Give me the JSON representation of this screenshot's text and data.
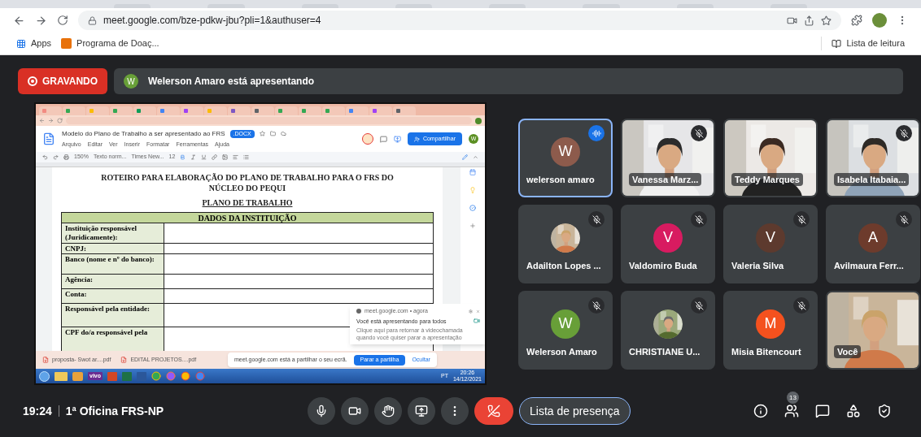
{
  "browser": {
    "url": "meet.google.com/bze-pdkw-jbu?pli=1&authuser=4",
    "bookmarks": [
      {
        "kind": "apps",
        "label": "Apps"
      },
      {
        "kind": "site",
        "label": "Programa de Doaç..."
      }
    ],
    "reading_list": "Lista de leitura"
  },
  "meet": {
    "recording": "GRAVANDO",
    "presenter": {
      "initial": "W",
      "text": "Welerson Amaro está apresentando"
    }
  },
  "shared_screen": {
    "doc": {
      "title": "Modelo do Plano de Trabalho a ser apresentado ao FRS",
      "badge": ".DOCX",
      "menu": [
        "Arquivo",
        "Editar",
        "Ver",
        "Inserir",
        "Formatar",
        "Ferramentas",
        "Ajuda"
      ],
      "share": "Compartilhar",
      "account": "W",
      "toolbar": [
        "150%",
        "Texto norm...",
        "Times New...",
        "12"
      ],
      "heading": "ROTEIRO PARA ELABORAÇÃO DO PLANO DE TRABALHO PARA O FRS DO NÚCLEO DO PEQUI",
      "subtitle": "PLANO DE TRABALHO",
      "table": {
        "header": "DADOS DA INSTITUIÇÃO",
        "rows": [
          "Instituição responsável (Juridicamente):",
          "CNPJ:",
          "Banco (nome e nº do banco):",
          "Agência:",
          "Conta:",
          "Responsável pela entidade:",
          "CPF do/a responsável pela"
        ]
      }
    },
    "downloads": [
      "proposta- Swot ar....pdf",
      "EDITAL PROJETOS....pdf"
    ],
    "share_bar": {
      "text": "meet.google.com está a partilhar o seu ecrã.",
      "stop": "Parar a partilha",
      "hide": "Ocultar"
    },
    "notification": {
      "source": "meet.google.com • agora",
      "title": "Você está apresentando para todos",
      "body": "Clique aqui para retornar à videochamada quando você quiser parar a apresentação"
    },
    "taskbar": {
      "vivo": "vivo",
      "lang": "PT",
      "time": "20:26",
      "date": "14/12/2021"
    }
  },
  "tiles": [
    {
      "name": "welerson amaro",
      "kind": "avatar",
      "initial": "W",
      "color": "#8d5b4c",
      "muted": false,
      "speaking": true,
      "selected": true
    },
    {
      "name": "Vanessa Marz...",
      "kind": "video",
      "muted": true,
      "speaking": false,
      "selected": false
    },
    {
      "name": "Teddy Marques",
      "kind": "video",
      "muted": false,
      "speaking": false,
      "selected": false
    },
    {
      "name": "Isabela Itabaia...",
      "kind": "video",
      "muted": true,
      "speaking": false,
      "selected": false
    },
    {
      "name": "Adailton Lopes ...",
      "kind": "photo_avatar",
      "muted": true,
      "speaking": false,
      "selected": false
    },
    {
      "name": "Valdomiro Buda",
      "kind": "avatar",
      "initial": "V",
      "color": "#d81b60",
      "muted": true,
      "speaking": false,
      "selected": false
    },
    {
      "name": "Valeria Silva",
      "kind": "avatar",
      "initial": "V",
      "color": "#5d3a2e",
      "muted": true,
      "speaking": false,
      "selected": false
    },
    {
      "name": "Avilmaura Ferr...",
      "kind": "avatar",
      "initial": "A",
      "color": "#6d3b2c",
      "muted": true,
      "speaking": false,
      "selected": false
    },
    {
      "name": "Welerson Amaro",
      "kind": "avatar",
      "initial": "W",
      "color": "#689f38",
      "muted": true,
      "speaking": false,
      "selected": false
    },
    {
      "name": "CHRISTIANE U...",
      "kind": "photo_avatar",
      "muted": true,
      "speaking": false,
      "selected": false
    },
    {
      "name": "Misia Bitencourt",
      "kind": "avatar",
      "initial": "M",
      "color": "#f4511e",
      "muted": true,
      "speaking": false,
      "selected": false
    },
    {
      "name": "Você",
      "kind": "video",
      "muted": false,
      "speaking": false,
      "selected": false
    }
  ],
  "bottom": {
    "time": "19:24",
    "meeting": "1ª Oficina FRS-NP",
    "presence": "Lista de presença",
    "people_count": "13"
  }
}
